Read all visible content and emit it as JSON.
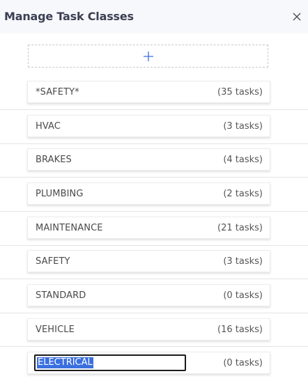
{
  "dialog": {
    "title": "Manage Task Classes",
    "close_icon": "close-icon",
    "add_icon": "plus-icon"
  },
  "task_classes": [
    {
      "name": "*SAFETY*",
      "count": "(35 tasks)"
    },
    {
      "name": "HVAC",
      "count": "(3 tasks)"
    },
    {
      "name": "BRAKES",
      "count": "(4 tasks)"
    },
    {
      "name": "PLUMBING",
      "count": "(2 tasks)"
    },
    {
      "name": "MAINTENANCE",
      "count": "(21 tasks)"
    },
    {
      "name": "SAFETY",
      "count": "(3 tasks)"
    },
    {
      "name": "STANDARD",
      "count": "(0 tasks)"
    },
    {
      "name": "VEHICLE",
      "count": "(16 tasks)"
    },
    {
      "name": "ELECTRICAL",
      "count": "(0 tasks)",
      "editing": true
    }
  ],
  "colors": {
    "header_bg": "#f7f8fb",
    "title": "#3b3f52",
    "accent": "#3a6fe0",
    "selection_bg": "#3a6fe0"
  }
}
